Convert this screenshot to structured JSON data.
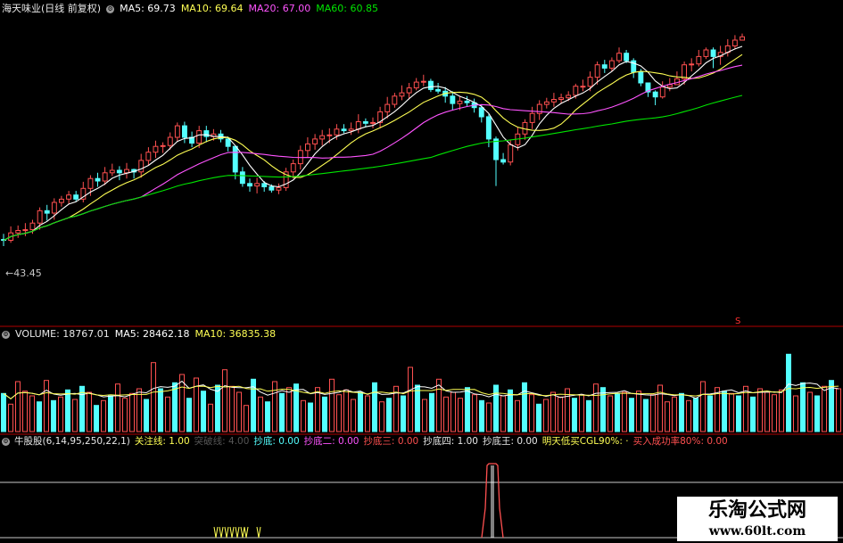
{
  "price_header": {
    "stock": "海天味业(日线 前复权)",
    "ma5": "MA5: 69.73",
    "ma10": "MA10: 69.64",
    "ma20": "MA20: 67.00",
    "ma60": "MA60: 60.85"
  },
  "volume_header": {
    "volume": "VOLUME: 18767.01",
    "ma5": "MA5: 28462.18",
    "ma10": "MA10: 36835.38"
  },
  "indicator_header": {
    "name": "牛股股(6,14,95,250,22,1)",
    "guanzhu": "关注线: 1.00",
    "tupo": "突破线: 4.00",
    "chaodi": "抄底: 0.00",
    "chaodi2": "抄底二: 0.00",
    "chaodi3": "抄底三: 0.00",
    "chaodi4": "抄底四: 1.00",
    "chaodiwang": "抄底王: 0.00",
    "mingtian": "明天低买CGL90%: ·",
    "mairu": "买入成功率80%: 0.00"
  },
  "price_annotation": "←43.45",
  "sell_marker": "S",
  "watermark": {
    "line1": "乐淘公式网",
    "line2": "www.60lt.com"
  },
  "colors": {
    "background": "#000000",
    "up_candle": "#ff5050",
    "down_candle": "#54ffff",
    "ma5": "#ffffff",
    "ma10": "#ffff54",
    "ma20": "#ff54ff",
    "ma60": "#00e600",
    "separator": "#b00000"
  },
  "chart_data": [
    {
      "type": "candlestick",
      "name": "price",
      "ma_periods": [
        5,
        10,
        20,
        60
      ],
      "close": [
        44.0,
        44.9,
        45.2,
        45.3,
        46.1,
        47.6,
        47.3,
        48.6,
        49.0,
        49.5,
        49.0,
        50.3,
        51.5,
        51.2,
        52.2,
        52.5,
        52.2,
        52.6,
        52.3,
        53.7,
        54.7,
        55.4,
        55.5,
        56.5,
        57.9,
        56.5,
        55.8,
        57.3,
        56.6,
        56.9,
        56.3,
        55.4,
        52.3,
        50.9,
        50.6,
        50.9,
        50.5,
        50.1,
        50.4,
        52.3,
        53.3,
        54.9,
        55.7,
        56.3,
        56.7,
        56.8,
        57.5,
        57.3,
        57.5,
        58.4,
        58.2,
        58.3,
        59.6,
        60.5,
        61.5,
        61.9,
        62.5,
        63.2,
        63.3,
        62.3,
        62.1,
        61.5,
        60.6,
        60.9,
        60.7,
        60.1,
        59.0,
        56.3,
        53.8,
        53.5,
        55.6,
        56.9,
        58.3,
        59.4,
        60.5,
        60.8,
        61.1,
        61.3,
        61.6,
        62.7,
        62.7,
        63.8,
        65.3,
        64.9,
        65.8,
        66.7,
        65.8,
        64.4,
        63.1,
        62.0,
        61.4,
        62.6,
        62.9,
        63.6,
        65.3,
        65.4,
        66.3,
        67.1,
        66.3,
        66.8,
        67.6,
        68.3,
        68.7
      ],
      "open": [
        44.1,
        44.0,
        44.9,
        45.2,
        45.3,
        46.1,
        47.6,
        47.3,
        48.6,
        49.0,
        49.5,
        49.0,
        50.3,
        51.5,
        51.2,
        52.2,
        52.5,
        52.2,
        52.6,
        52.3,
        53.7,
        54.7,
        55.4,
        55.5,
        56.5,
        57.9,
        56.5,
        55.8,
        57.3,
        56.6,
        56.9,
        56.3,
        55.4,
        52.3,
        50.9,
        50.6,
        50.9,
        50.5,
        50.1,
        50.4,
        52.3,
        53.3,
        54.9,
        55.7,
        56.3,
        56.7,
        56.8,
        57.5,
        57.3,
        57.5,
        58.4,
        58.2,
        58.3,
        59.6,
        60.5,
        61.5,
        61.9,
        62.5,
        63.2,
        63.3,
        62.3,
        62.1,
        61.5,
        60.6,
        60.9,
        60.7,
        60.1,
        59.0,
        56.3,
        53.8,
        53.5,
        55.6,
        56.9,
        58.3,
        59.4,
        60.5,
        60.8,
        61.1,
        61.3,
        61.6,
        62.7,
        62.7,
        63.8,
        65.3,
        64.9,
        65.8,
        66.7,
        65.8,
        64.4,
        63.1,
        62.0,
        61.4,
        62.6,
        62.9,
        63.6,
        65.3,
        65.4,
        66.3,
        67.1,
        66.3,
        66.8,
        67.6,
        68.3
      ],
      "high": [
        44.8,
        45.7,
        45.8,
        46.1,
        46.5,
        48.0,
        48.3,
        49.1,
        49.4,
        50.0,
        50.0,
        51.1,
        51.9,
        52.2,
        52.9,
        53.3,
        53.0,
        53.4,
        52.7,
        54.5,
        55.3,
        56.1,
        55.9,
        57.1,
        58.3,
        58.4,
        57.2,
        57.9,
        57.9,
        57.5,
        57.4,
        56.6,
        55.5,
        52.9,
        51.5,
        51.6,
        51.2,
        50.8,
        50.9,
        52.8,
        53.8,
        55.5,
        56.5,
        56.9,
        57.4,
        57.6,
        58.1,
        58.1,
        58.3,
        59.3,
        58.8,
        58.9,
        60.2,
        61.4,
        61.9,
        62.8,
        63.1,
        63.7,
        64.1,
        63.6,
        63.1,
        62.6,
        62.1,
        61.5,
        61.5,
        61.2,
        60.5,
        59.3,
        56.6,
        54.6,
        56.2,
        57.7,
        58.7,
        60.2,
        61.0,
        61.3,
        61.9,
        61.8,
        62.1,
        63.0,
        63.5,
        64.5,
        65.7,
        65.9,
        66.2,
        67.4,
        67.1,
        66.1,
        64.8,
        63.1,
        62.2,
        63.3,
        63.7,
        64.5,
        65.7,
        66.1,
        67.1,
        67.4,
        67.4,
        67.6,
        68.4,
        68.9,
        69.1
      ],
      "low": [
        43.3,
        43.7,
        44.3,
        44.5,
        44.8,
        45.3,
        46.4,
        46.5,
        48.1,
        48.4,
        48.7,
        48.6,
        49.4,
        50.5,
        50.7,
        51.8,
        51.3,
        51.5,
        51.5,
        51.6,
        53.1,
        54.0,
        54.6,
        55.0,
        56.0,
        55.8,
        55.3,
        55.2,
        55.9,
        56.1,
        55.9,
        54.8,
        51.4,
        50.5,
        49.9,
        49.7,
        49.9,
        49.8,
        49.6,
        50.0,
        51.5,
        52.6,
        54.1,
        55.0,
        55.5,
        55.8,
        56.2,
        57.0,
        56.8,
        57.0,
        57.7,
        57.6,
        57.6,
        58.8,
        60.1,
        61.0,
        61.1,
        62.2,
        62.7,
        62.0,
        61.8,
        60.7,
        59.8,
        59.8,
        60.3,
        59.5,
        58.3,
        55.3,
        50.6,
        53.2,
        53.1,
        54.9,
        56.2,
        57.5,
        58.6,
        60.0,
        60.2,
        60.6,
        60.9,
        61.2,
        62.1,
        62.1,
        62.9,
        64.3,
        64.5,
        65.5,
        65.5,
        63.7,
        62.7,
        61.4,
        60.4,
        61.2,
        62.1,
        63.1,
        62.9,
        64.5,
        65.1,
        66.0,
        64.9,
        65.3,
        66.3,
        67.2,
        68.3
      ],
      "ylim": [
        34,
        71
      ]
    },
    {
      "type": "bar",
      "name": "volume",
      "ma_periods": [
        5,
        10
      ],
      "values": [
        32000,
        23000,
        42000,
        34000,
        30000,
        25000,
        43000,
        26000,
        29000,
        35000,
        27000,
        38000,
        33000,
        22000,
        26000,
        30000,
        40000,
        28000,
        32000,
        36000,
        27000,
        58000,
        36000,
        29000,
        41000,
        48000,
        28000,
        45000,
        34000,
        23000,
        39000,
        52000,
        38000,
        33000,
        22000,
        44000,
        29000,
        25000,
        42000,
        32000,
        37000,
        40000,
        26000,
        24000,
        37000,
        29000,
        44000,
        31000,
        35000,
        27000,
        33000,
        30000,
        41000,
        25000,
        28000,
        38000,
        30000,
        54000,
        39000,
        27000,
        32000,
        44000,
        29000,
        33000,
        28000,
        37000,
        31000,
        26000,
        24000,
        39000,
        30000,
        35000,
        26000,
        41000,
        31000,
        23000,
        27000,
        33000,
        29000,
        36000,
        28000,
        31000,
        26000,
        40000,
        37000,
        30000,
        32000,
        33000,
        28000,
        34000,
        27000,
        31000,
        39000,
        25000,
        29000,
        32000,
        26000,
        28000,
        42000,
        30000,
        37000,
        34000,
        32000,
        30000,
        38000,
        29000,
        36000,
        33000,
        31000,
        35000,
        65000,
        30000,
        41000,
        33000,
        30000,
        38000,
        43000,
        36000
      ],
      "ylim": [
        0,
        75000
      ]
    },
    {
      "type": "line",
      "name": "indicator",
      "ylim": [
        0,
        5
      ]
    }
  ]
}
